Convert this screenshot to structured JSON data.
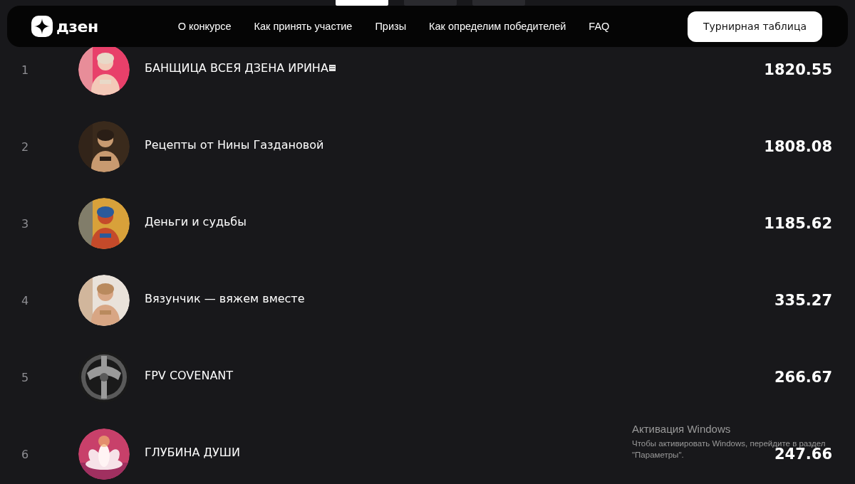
{
  "period_tabs": [
    {
      "selected": true
    },
    {
      "selected": false
    },
    {
      "selected": false
    }
  ],
  "header": {
    "logo": "дзен",
    "nav": [
      "О конкурсе",
      "Как принять участие",
      "Призы",
      "Как определим победителей",
      "FAQ"
    ],
    "button": "Турнирная таблица"
  },
  "rows": [
    {
      "rank": "1",
      "name": "БАНЩИЦА ВСЕЯ ДЗЕНА ИРИНА",
      "trailing_glyph": true,
      "score": "1820.55"
    },
    {
      "rank": "2",
      "name": "Рецепты от Нины Газдановой",
      "trailing_glyph": false,
      "score": "1808.08"
    },
    {
      "rank": "3",
      "name": "Деньги и судьбы",
      "trailing_glyph": false,
      "score": "1185.62"
    },
    {
      "rank": "4",
      "name": "Вязунчик — вяжем вместе",
      "trailing_glyph": false,
      "score": "335.27"
    },
    {
      "rank": "5",
      "name": "FPV COVENANT",
      "trailing_glyph": false,
      "score": "266.67"
    },
    {
      "rank": "6",
      "name": "ГЛУБИНА ДУШИ",
      "trailing_glyph": false,
      "score": "247.66"
    }
  ],
  "os_notice": {
    "title": "Активация Windows",
    "lines": [
      "Чтобы активировать Windows, перейдите в раздел",
      "\"Параметры\"."
    ]
  }
}
